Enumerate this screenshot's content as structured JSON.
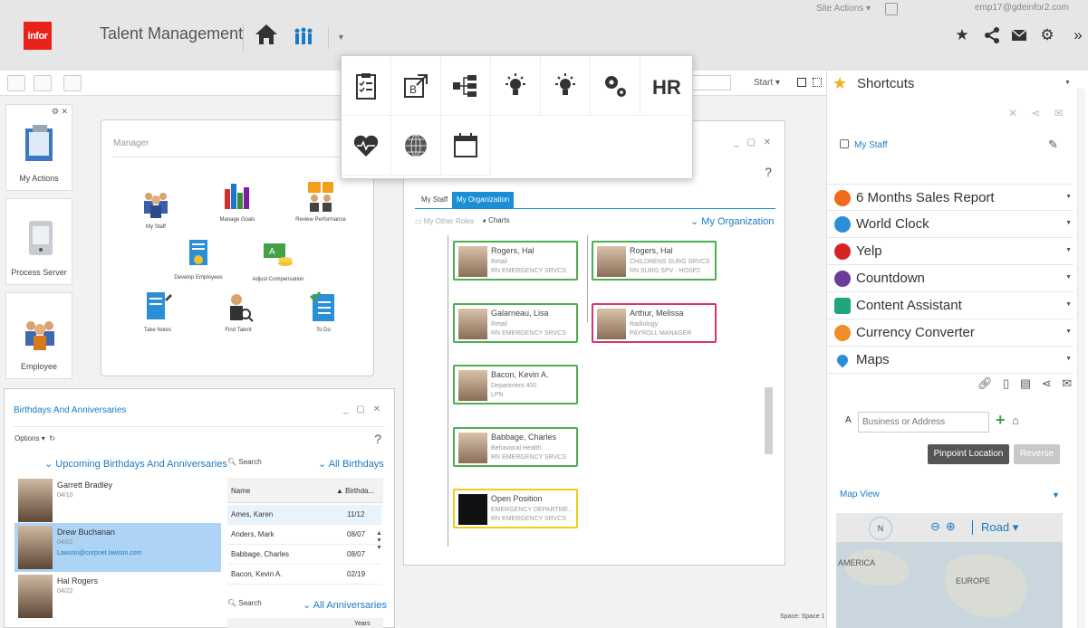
{
  "header": {
    "logo": "infor",
    "app_title": "Talent Management",
    "site_actions": "Site Actions",
    "user_email": "emp17@gdeinfor2.com"
  },
  "toolbar": {
    "start_label": "Start"
  },
  "launchers": [
    {
      "label": "My Actions"
    },
    {
      "label": "Process Server"
    },
    {
      "label": "Employee"
    }
  ],
  "manager": {
    "title": "Manager",
    "items": [
      {
        "label": "My Staff"
      },
      {
        "label": "Manage Goals"
      },
      {
        "label": "Review Performance"
      },
      {
        "label": "Develop Employees"
      },
      {
        "label": "Adjust Compensation"
      },
      {
        "label": "Take Notes"
      },
      {
        "label": "Find Talent"
      },
      {
        "label": "To Do"
      }
    ]
  },
  "org": {
    "help": "?",
    "tabs": [
      "My Staff",
      "My Organization"
    ],
    "other_roles": "My Other Roles",
    "charts": "Charts",
    "org_link": "My Organization",
    "cards": [
      {
        "name": "Rogers, Hal",
        "sub1": "Retail",
        "sub2": "RN EMERGENCY SRVCS"
      },
      {
        "name": "Rogers, Hal",
        "sub1": "CHILDRENS SURG SRVCS",
        "sub2": "RN SURG SPV - HOSP2"
      },
      {
        "name": "Galarneau, Lisa",
        "sub1": "Retail",
        "sub2": "RN EMERGENCY SRVCS"
      },
      {
        "name": "Arthur, Melissa",
        "sub1": "Radiology",
        "sub2": "PAYROLL MANAGER"
      },
      {
        "name": "Bacon, Kevin A.",
        "sub1": "Department 400",
        "sub2": "LPN"
      },
      {
        "name": "Babbage, Charles",
        "sub1": "Behavioral Health",
        "sub2": "RN EMERGENCY SRVCS"
      },
      {
        "name": "Open Position",
        "sub1": "EMERGENCY DEPARTME...",
        "sub2": "RN EMERGENCY SRVCS"
      }
    ],
    "space": "Space: Space 1"
  },
  "bday": {
    "title": "Birthdays And Anniversaries",
    "options": "Options",
    "help": "?",
    "upcoming": "Upcoming Birthdays And Anniversaries",
    "search1": "Search",
    "all_birthdays": "All Birthdays",
    "col_name": "Name",
    "col_birth": "Birthda...",
    "people": [
      {
        "name": "Garrett Bradley",
        "date": "04/10",
        "email": ""
      },
      {
        "name": "Drew Buchanan",
        "date": "04/02",
        "email": "Lawson@corpnet.lawson.com"
      },
      {
        "name": "Hal Rogers",
        "date": "04/22",
        "email": ""
      }
    ],
    "rows": [
      {
        "name": "Ames, Karen",
        "date": "11/12"
      },
      {
        "name": "Anders, Mark",
        "date": "08/07"
      },
      {
        "name": "Babbage, Charles",
        "date": "08/07"
      },
      {
        "name": "Bacon, Kevin A.",
        "date": "02/19"
      }
    ],
    "search2": "Search",
    "all_anniversaries": "All Anniversaries",
    "col_years": "Years"
  },
  "sidebar": {
    "title": "Shortcuts",
    "my_staff": "My Staff",
    "items": [
      {
        "label": "6 Months Sales Report",
        "color": "#f26a1b"
      },
      {
        "label": "World Clock",
        "color": "#2a8fd6"
      },
      {
        "label": "Yelp",
        "color": "#d32323"
      },
      {
        "label": "Countdown",
        "color": "#6a3d9a"
      },
      {
        "label": "Content Assistant",
        "color": "#1ea77e"
      },
      {
        "label": "Currency Converter",
        "color": "#f28c28"
      },
      {
        "label": "Maps",
        "color": "#2a8fd6"
      }
    ],
    "address_marker": "A",
    "address_placeholder": "Business or Address",
    "pinpoint": "Pinpoint Location",
    "reverse": "Reverse",
    "map_view": "Map View",
    "road": "Road",
    "north": "N",
    "america": "AMERICA",
    "europe": "EUROPE"
  }
}
